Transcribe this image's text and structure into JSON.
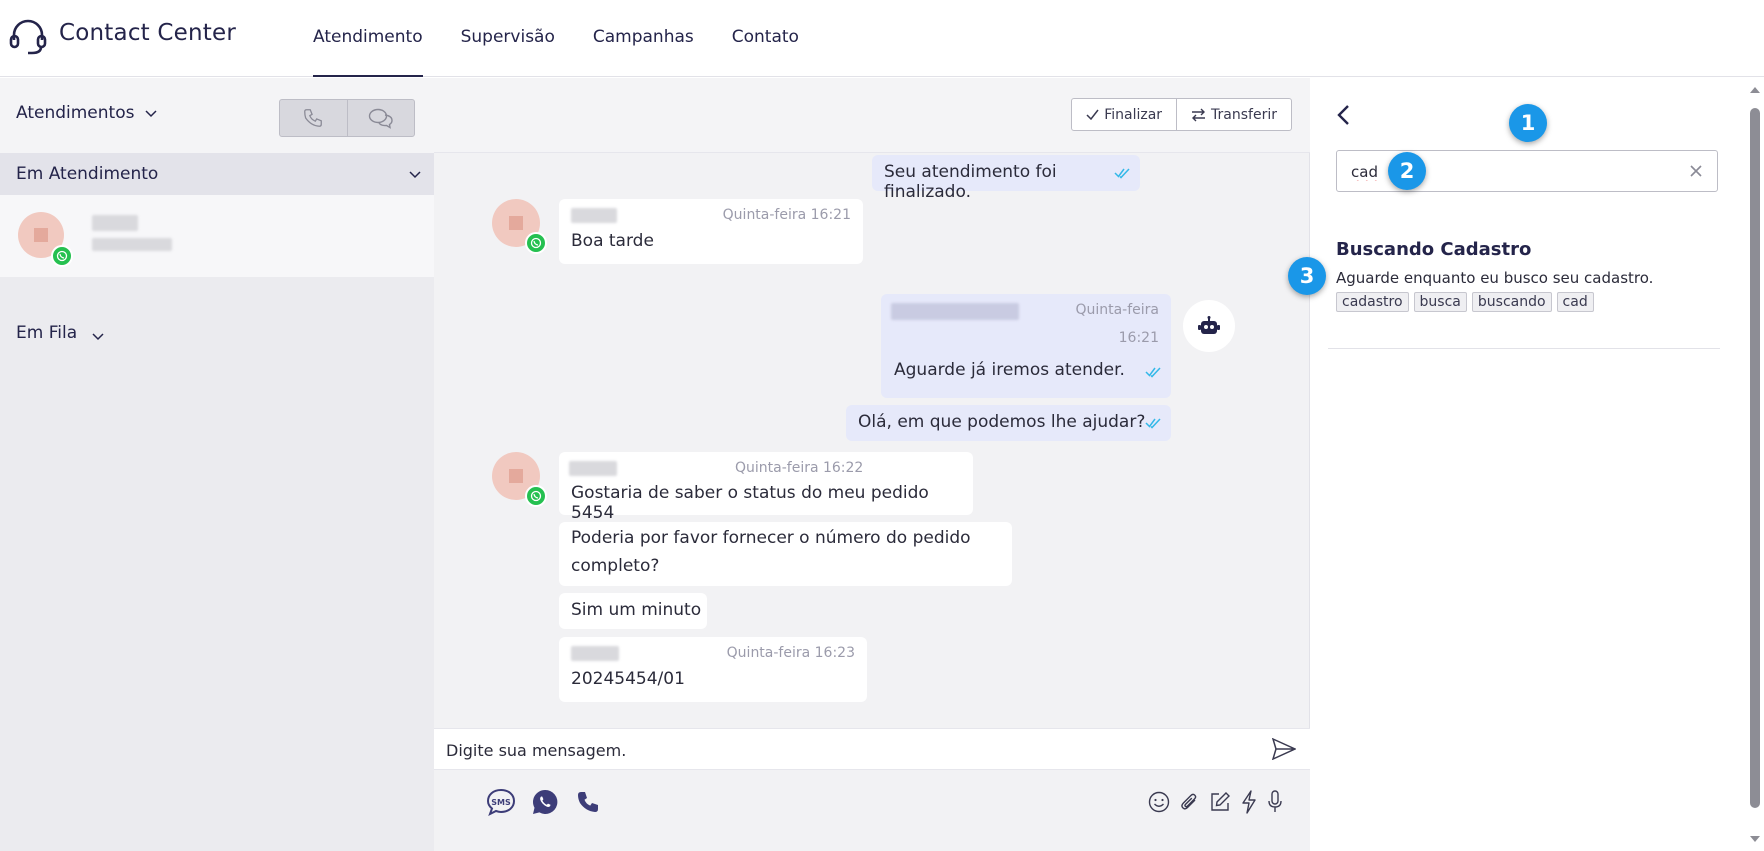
{
  "app": {
    "title": "Contact Center"
  },
  "nav": {
    "items": [
      "Atendimento",
      "Supervisão",
      "Campanhas",
      "Contato"
    ],
    "active": "Atendimento"
  },
  "left": {
    "title": "Atendimentos",
    "section_active": "Em Atendimento",
    "section_queue": "Em Fila"
  },
  "chat": {
    "buttons": {
      "finalize": "Finalizar",
      "transfer": "Transferir"
    },
    "messages": [
      {
        "text": "Seu atendimento foi finalizado."
      },
      {
        "time": "Quinta-feira 16:21",
        "text": "Boa tarde"
      },
      {
        "time_line1": "Quinta-feira",
        "time_line2": "16:21",
        "text": "Aguarde já iremos atender."
      },
      {
        "text": "Olá, em que podemos lhe ajudar?"
      },
      {
        "time": "Quinta-feira 16:22",
        "text": "Gostaria de saber o status do meu pedido 5454"
      },
      {
        "text_line1": "Poderia por favor fornecer o número do pedido",
        "text_line2": "completo?"
      },
      {
        "text": "Sim um minuto"
      },
      {
        "time": "Quinta-feira 16:23",
        "text": "20245454/01"
      }
    ],
    "composer": {
      "placeholder": "Digite sua mensagem."
    }
  },
  "right": {
    "search": {
      "value": "cad"
    },
    "result": {
      "title": "Buscando Cadastro",
      "description": "Aguarde enquanto eu busco seu cadastro.",
      "tags": [
        "cadastro",
        "busca",
        "buscando",
        "cad"
      ]
    },
    "badges": [
      "1",
      "2",
      "3"
    ]
  },
  "colors": {
    "accent": "#24244a",
    "badge": "#1a97e8",
    "whatsapp": "#25c050",
    "outgoing_bubble": "#e6e9fa"
  }
}
